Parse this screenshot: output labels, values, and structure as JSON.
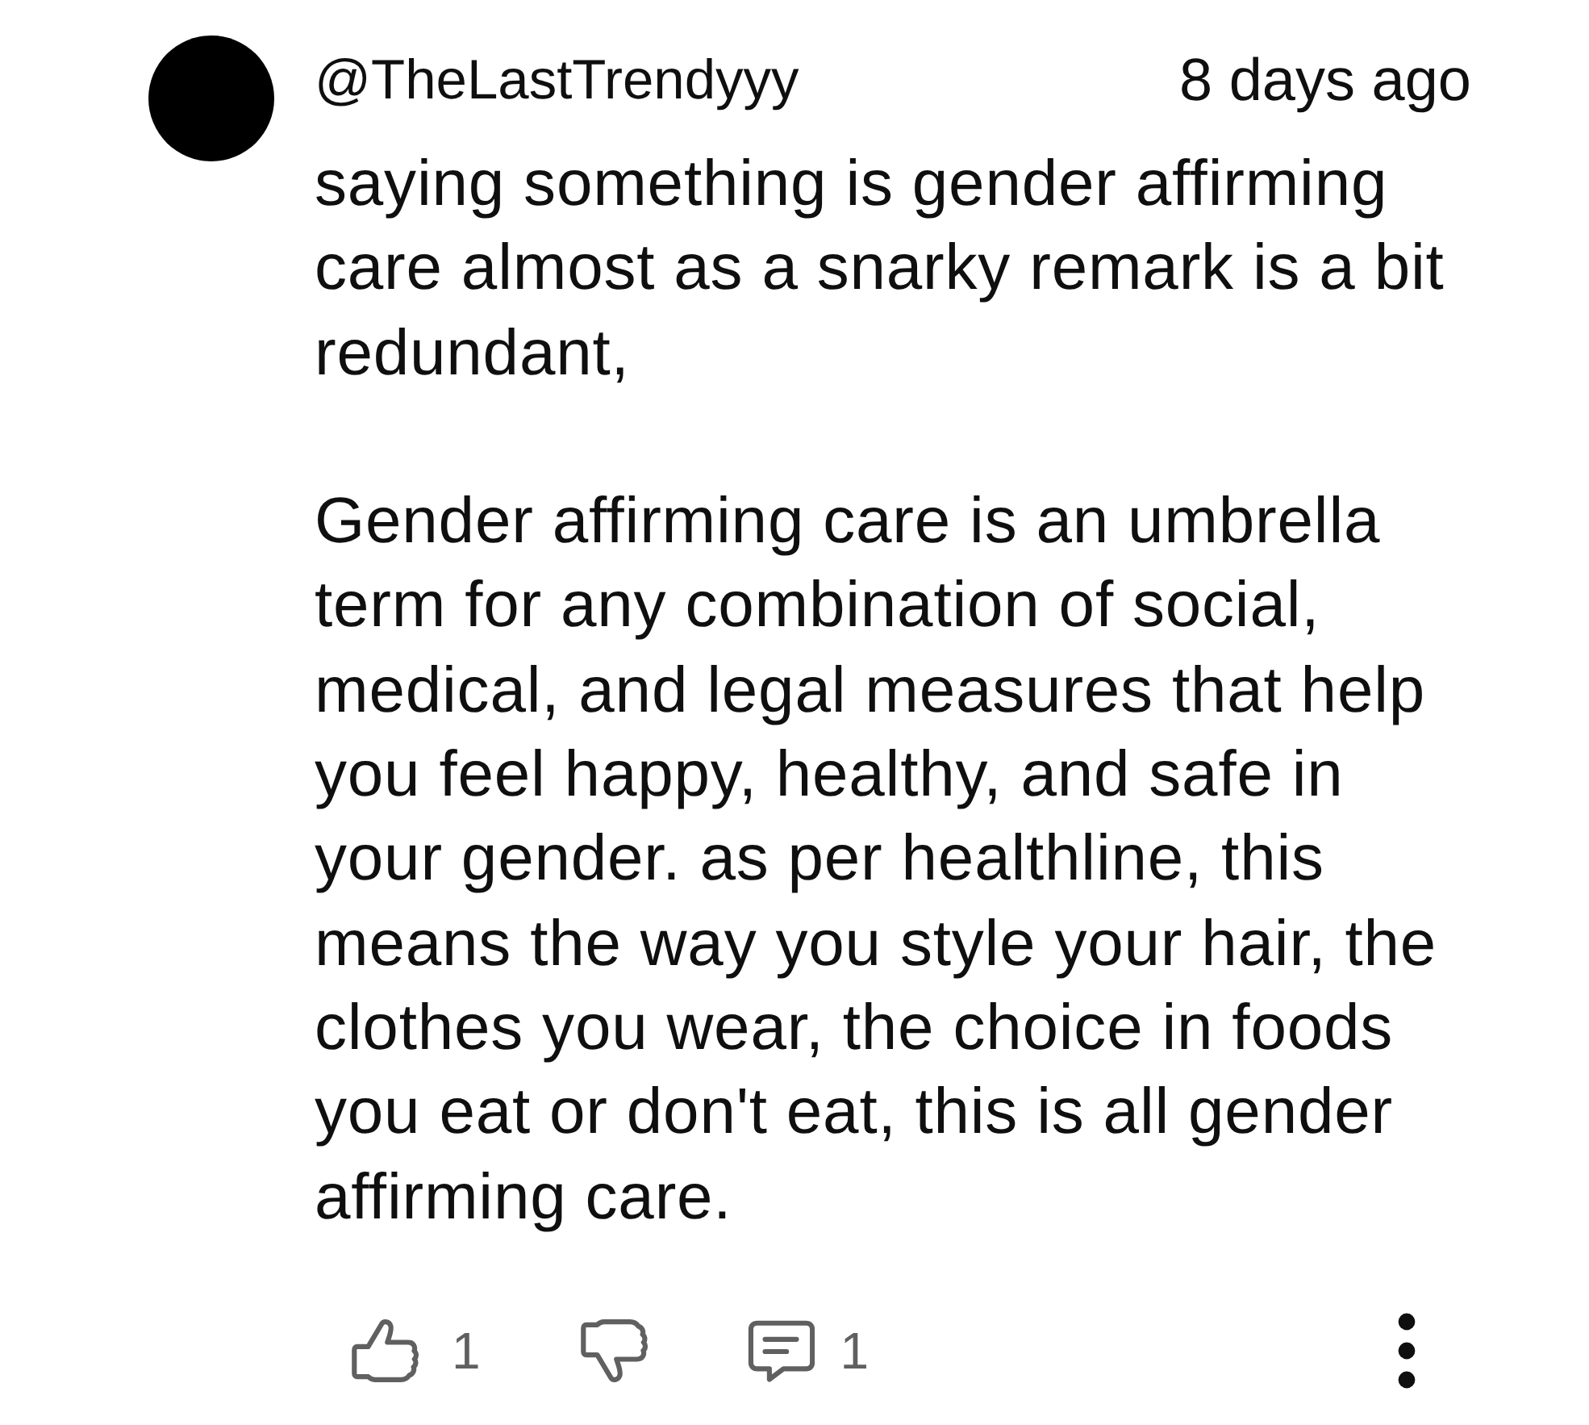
{
  "comment": {
    "author": "@TheLastTrendyyy",
    "time": "8 days ago",
    "paragraphs": [
      "saying something is gender affirming\ncare almost as a snarky remark is a bit\nredundant,",
      "Gender affirming care is an umbrella\nterm for any combination of social,\nmedical, and legal measures that help\nyou feel happy, healthy, and safe in\nyour gender. as per healthline, this\nmeans the way you style your hair, the\nclothes you wear, the choice in foods\nyou eat or don't eat, this is all gender\naffirming care."
    ]
  },
  "actions": {
    "likes": "1",
    "replies": "1"
  }
}
